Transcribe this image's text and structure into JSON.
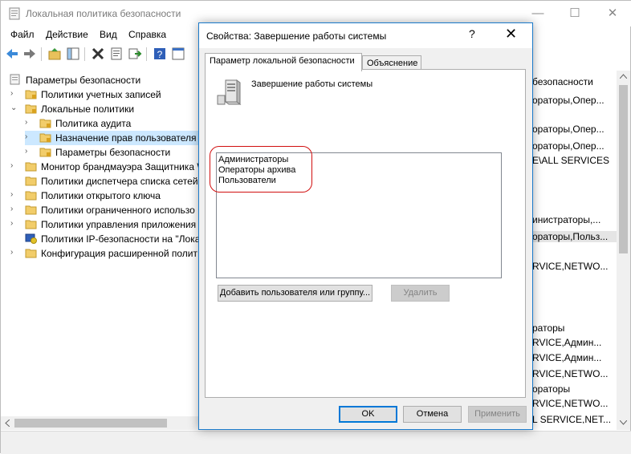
{
  "window": {
    "title": "Локальная политика безопасности",
    "controls": {
      "minimize": "—",
      "maximize": "☐",
      "close": "✕"
    }
  },
  "menu": [
    "Файл",
    "Действие",
    "Вид",
    "Справка"
  ],
  "tree": {
    "root": "Параметры безопасности",
    "items": [
      "Политики учетных записей",
      "Локальные политики",
      "Политика аудита",
      "Назначение прав пользователя",
      "Параметры безопасности",
      "Монитор брандмауэра Защитника W",
      "Политики диспетчера списка сетей",
      "Политики открытого ключа",
      "Политики ограниченного использо",
      "Политики управления приложения",
      "Политики IP-безопасности на \"Лока",
      "Конфигурация расширенной полит"
    ]
  },
  "right_column": [
    "безопасности",
    "ораторы,Опер...",
    "ораторы,Опер...",
    "ораторы,Опер...",
    "E\\ALL SERVICES",
    "инистраторы,...",
    "ораторы,Польз...",
    "RVICE,NETWO...",
    "раторы",
    "RVICE,Админ...",
    "RVICE,Админ...",
    "RVICE,NETWO...",
    "ораторы",
    "RVICE,NETWO...",
    "L SERVICE,NET..."
  ],
  "dialog": {
    "title": "Свойства: Завершение работы системы",
    "help": "?",
    "close": "✕",
    "tabs": [
      "Параметр локальной безопасности",
      "Объяснение"
    ],
    "policy_title": "Завершение работы системы",
    "users": [
      "Администраторы",
      "Операторы архива",
      "Пользователи"
    ],
    "add_button": "Добавить пользователя или группу...",
    "remove_button": "Удалить",
    "ok": "OK",
    "cancel": "Отмена",
    "apply": "Применить"
  }
}
